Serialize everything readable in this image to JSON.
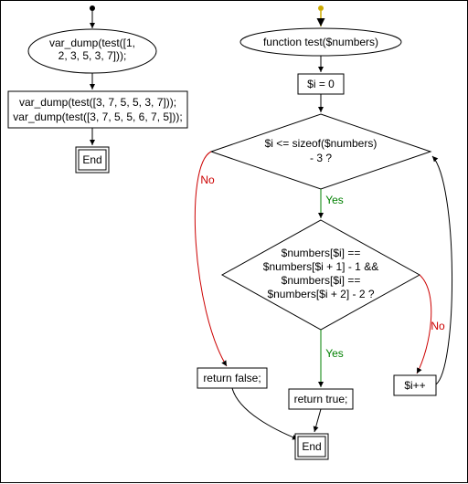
{
  "chart_data": {
    "type": "flowchart",
    "left_flow": {
      "start_node": {
        "lines": [
          "var_dump(test([1,",
          "2, 3, 5, 3, 7]));"
        ]
      },
      "rect_node": {
        "lines": [
          "var_dump(test([3, 7, 5, 5, 3, 7]));",
          "var_dump(test([3, 7, 5, 5, 6, 7, 5]));"
        ]
      },
      "end_node": "End"
    },
    "right_flow": {
      "start_node": "function test($numbers)",
      "init_node": "$i = 0",
      "cond1": {
        "lines": [
          "$i <= sizeof($numbers)",
          "- 3 ?"
        ]
      },
      "cond2": {
        "lines": [
          "$numbers[$i] ==",
          "$numbers[$i + 1] - 1 &&",
          "$numbers[$i] ==",
          "$numbers[$i + 2] - 2 ?"
        ]
      },
      "ret_false": "return false;",
      "ret_true": "return true;",
      "inc": "$i++",
      "end_node": "End"
    },
    "labels": {
      "yes": "Yes",
      "no": "No"
    }
  }
}
